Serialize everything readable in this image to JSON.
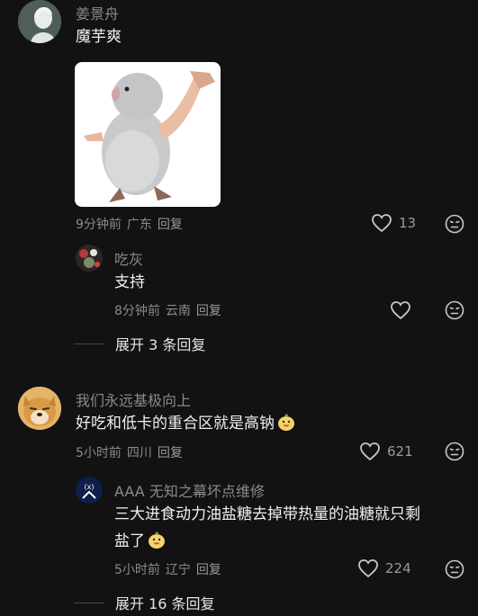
{
  "comments": [
    {
      "user": "姜景舟",
      "text": "魔芋爽",
      "time": "9分钟前",
      "location": "广东",
      "reply_label": "回复",
      "likes": "13",
      "replies": [
        {
          "user": "吃灰",
          "text": "支持",
          "time": "8分钟前",
          "location": "云南",
          "reply_label": "回复",
          "likes": ""
        }
      ],
      "expand_label": "展开 3 条回复"
    },
    {
      "user": "我们永远基极向上",
      "text": "好吃和低卡的重合区就是高钠",
      "time": "5小时前",
      "location": "四川",
      "reply_label": "回复",
      "likes": "621",
      "replies": [
        {
          "user": "AAA 无知之幕坏点维修",
          "text_line1": "三大进食动力油盐糖去掉带热量的油糖就只剩",
          "text_line2": "盐了",
          "time": "5小时前",
          "location": "辽宁",
          "reply_label": "回复",
          "likes": "224"
        }
      ],
      "expand_label": "展开 16 条回复"
    }
  ],
  "icons": {
    "like": "heart-outline-icon",
    "dislike": "meh-face-icon",
    "emoji": "grinning-pear-emoji"
  },
  "colors": {
    "background": "#121212",
    "text": "#f0f0f0",
    "muted": "#8a8a8a"
  }
}
